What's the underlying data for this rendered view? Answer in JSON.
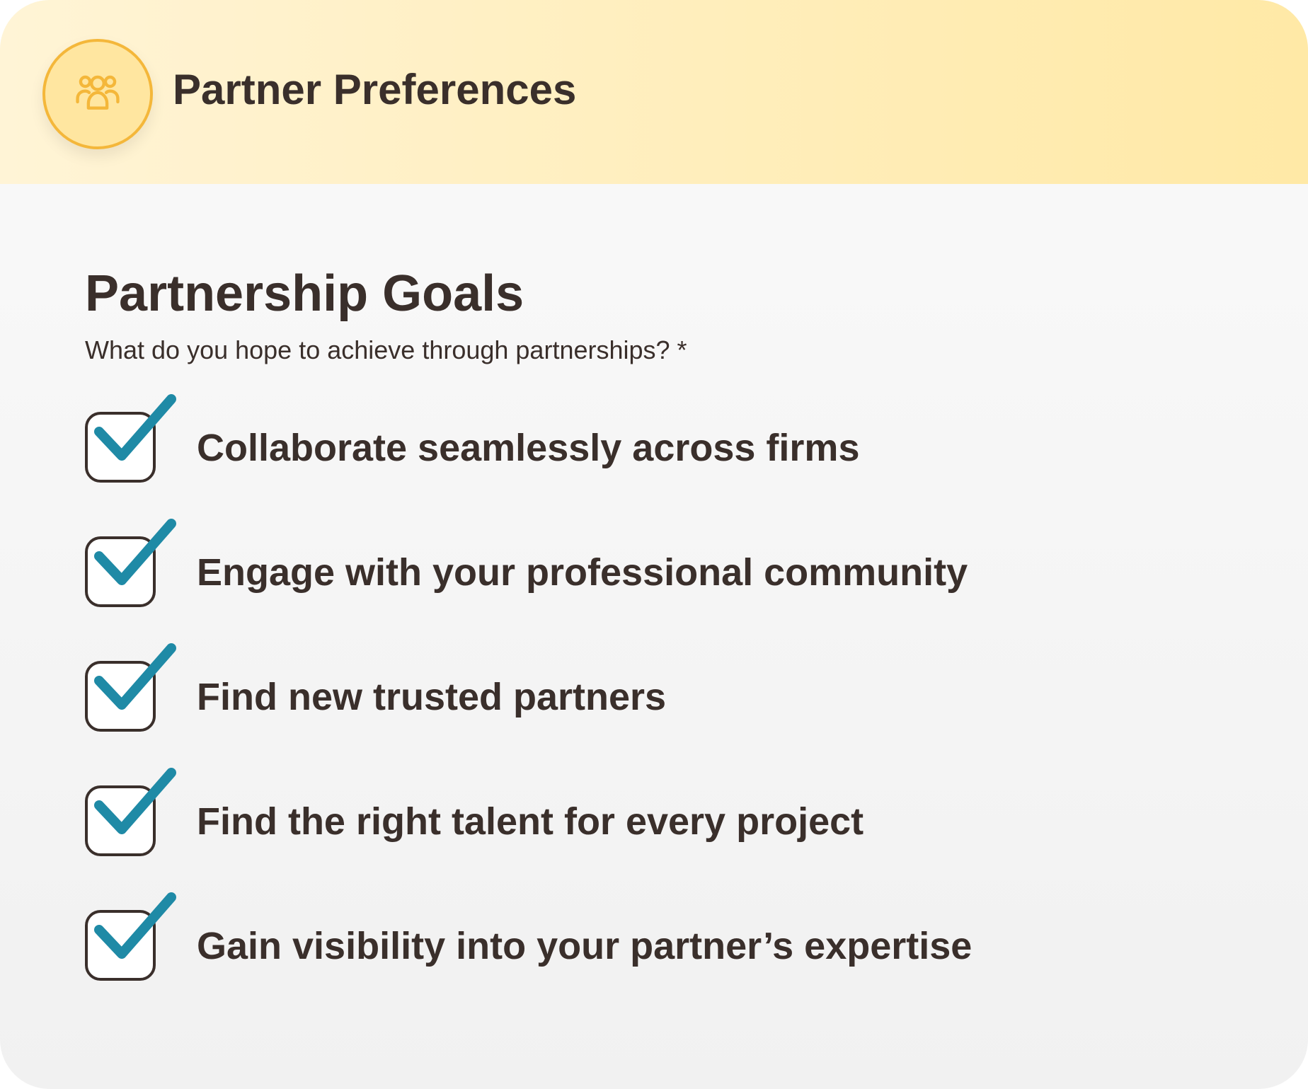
{
  "header": {
    "title": "Partner Preferences",
    "icon": "users-group-icon",
    "accent_color": "#f4b73a"
  },
  "section": {
    "title": "Partnership Goals",
    "question": "What do you hope to achieve through partnerships? *"
  },
  "options": [
    {
      "label": "Collaborate seamlessly across firms",
      "checked": true
    },
    {
      "label": "Engage with your professional community",
      "checked": true
    },
    {
      "label": "Find new trusted partners",
      "checked": true
    },
    {
      "label": "Find the right talent for every project",
      "checked": true
    },
    {
      "label": "Gain visibility into your partner’s expertise",
      "checked": true
    }
  ],
  "colors": {
    "checkmark": "#1f8aa6",
    "text": "#3a2f2b"
  }
}
